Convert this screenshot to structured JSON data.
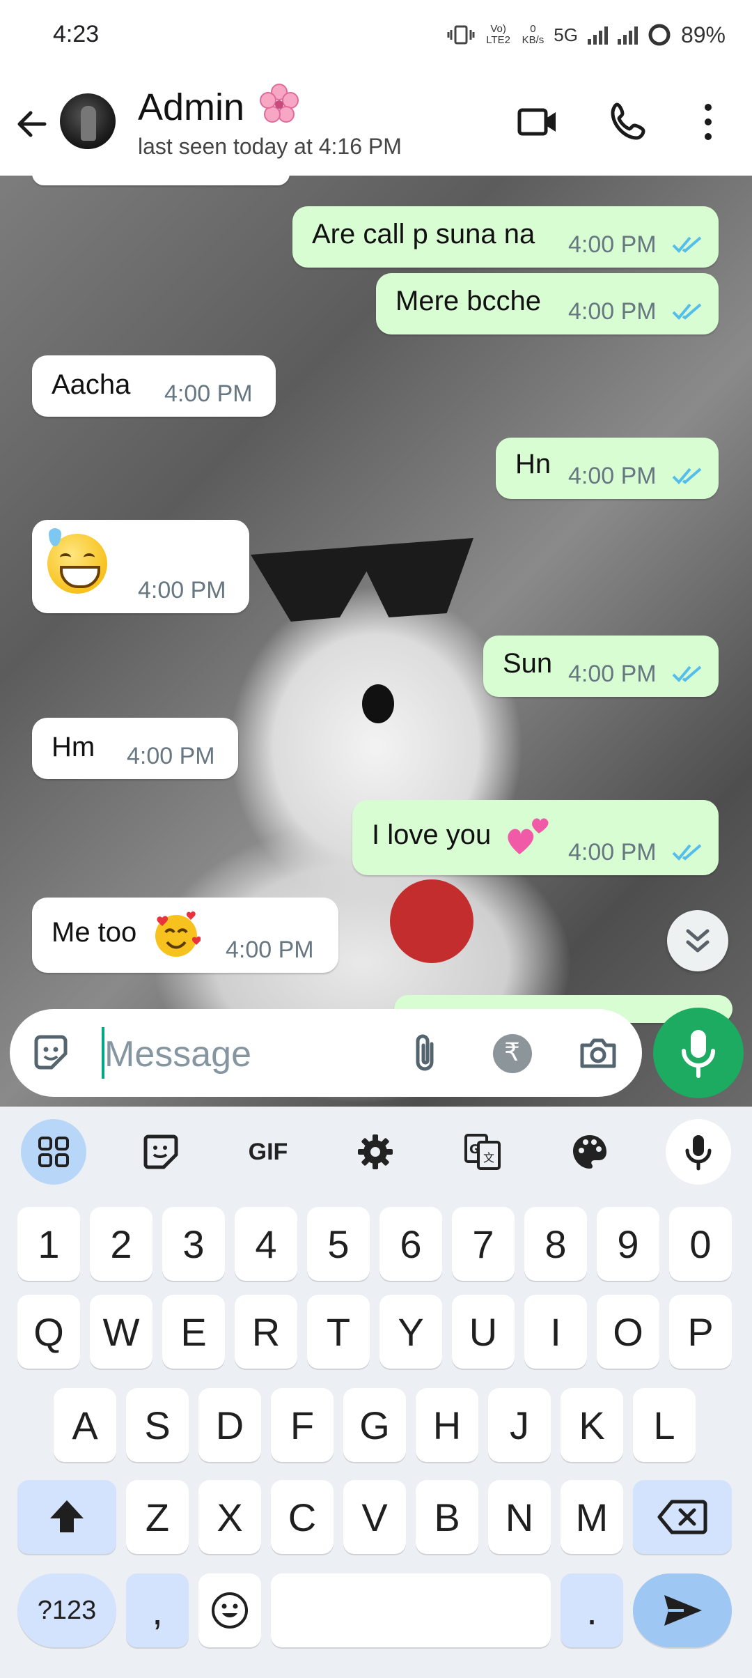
{
  "status_bar": {
    "time": "4:23",
    "volte": "Vo) LTE2",
    "data_rate_value": "0",
    "data_rate_unit": "KB/s",
    "network": "5G",
    "battery": "89%"
  },
  "header": {
    "contact_name": "Admin",
    "last_seen": "last seen today at 4:16 PM"
  },
  "messages": [
    {
      "dir": "out",
      "text": "Are call p suna na",
      "time": "4:00 PM"
    },
    {
      "dir": "out",
      "text": "Mere bcche",
      "time": "4:00 PM"
    },
    {
      "dir": "in",
      "text": "Aacha",
      "time": "4:00 PM"
    },
    {
      "dir": "out",
      "text": "Hn",
      "time": "4:00 PM"
    },
    {
      "dir": "in",
      "text": "",
      "emoji": "grinning-sweat-emoji",
      "time": "4:00 PM"
    },
    {
      "dir": "out",
      "text": "Sun",
      "time": "4:00 PM"
    },
    {
      "dir": "in",
      "text": "Hm",
      "time": "4:00 PM"
    },
    {
      "dir": "out",
      "text": "I love you",
      "emoji": "two-hearts-emoji",
      "time": "4:00 PM"
    },
    {
      "dir": "in",
      "text": "Me too",
      "emoji": "smiling-face-with-hearts-emoji",
      "time": "4:00 PM"
    }
  ],
  "composer": {
    "placeholder": "Message"
  },
  "keyboard": {
    "number_row": [
      "1",
      "2",
      "3",
      "4",
      "5",
      "6",
      "7",
      "8",
      "9",
      "0"
    ],
    "row1": [
      "Q",
      "W",
      "E",
      "R",
      "T",
      "Y",
      "U",
      "I",
      "O",
      "P"
    ],
    "row2": [
      "A",
      "S",
      "D",
      "F",
      "G",
      "H",
      "J",
      "K",
      "L"
    ],
    "row3": [
      "Z",
      "X",
      "C",
      "V",
      "B",
      "N",
      "M"
    ],
    "gif_label": "GIF",
    "symbols_label": "?123",
    "comma": ",",
    "period": "."
  },
  "colors": {
    "outgoing_bubble": "#d9fdd3",
    "incoming_bubble": "#ffffff",
    "read_ticks": "#53bdeb",
    "mic_button": "#1daa61",
    "keyboard_accent": "#d3e3fd"
  }
}
